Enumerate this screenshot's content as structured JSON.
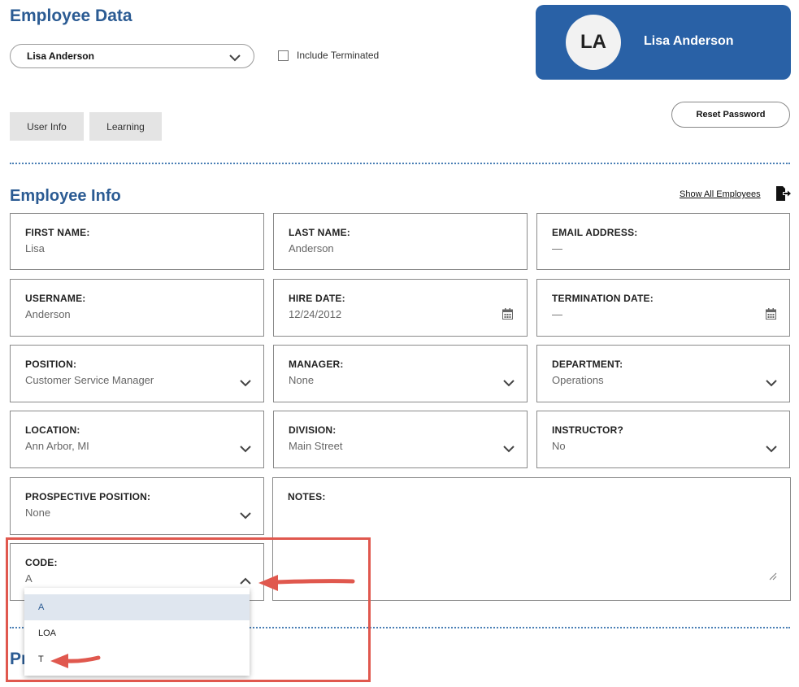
{
  "header": {
    "title": "Employee Data",
    "employee_select": {
      "value": "Lisa Anderson"
    },
    "include_terminated": {
      "label": "Include Terminated",
      "checked": false
    }
  },
  "profile": {
    "initials": "LA",
    "name": "Lisa Anderson",
    "card_color": "#2961a6"
  },
  "tabs": [
    {
      "label": "User Info"
    },
    {
      "label": "Learning"
    }
  ],
  "reset_password": {
    "label": "Reset Password"
  },
  "employee_info": {
    "title": "Employee Info",
    "show_all_link": "Show All Employees",
    "export_icon": "export-icon",
    "fields": {
      "first_name": {
        "label": "FIRST NAME:",
        "value": "Lisa"
      },
      "last_name": {
        "label": "LAST NAME:",
        "value": "Anderson"
      },
      "email": {
        "label": "EMAIL ADDRESS:",
        "value": "—"
      },
      "username": {
        "label": "USERNAME:",
        "value": "Anderson"
      },
      "hire_date": {
        "label": "HIRE DATE:",
        "value": "12/24/2012",
        "icon": "calendar-icon"
      },
      "termination_date": {
        "label": "TERMINATION DATE:",
        "value": "—",
        "icon": "calendar-icon"
      },
      "position": {
        "label": "POSITION:",
        "value": "Customer Service Manager"
      },
      "manager": {
        "label": "MANAGER:",
        "value": "None"
      },
      "department": {
        "label": "DEPARTMENT:",
        "value": "Operations"
      },
      "location": {
        "label": "LOCATION:",
        "value": "Ann Arbor, MI"
      },
      "division": {
        "label": "DIVISION:",
        "value": "Main Street"
      },
      "instructor": {
        "label": "INSTRUCTOR?",
        "value": "No"
      },
      "prospective_position": {
        "label": "PROSPECTIVE POSITION:",
        "value": "None"
      },
      "notes": {
        "label": "NOTES:",
        "value": ""
      },
      "code": {
        "label": "CODE:",
        "value": "A",
        "expanded": true
      }
    },
    "code_options": [
      {
        "label": "A",
        "selected": true
      },
      {
        "label": "LOA",
        "selected": false
      },
      {
        "label": "T",
        "selected": false
      }
    ]
  },
  "next_section_heading_fragment": "Pr",
  "annotation_color": "#e0584e",
  "accent_color": "#2b5b93"
}
